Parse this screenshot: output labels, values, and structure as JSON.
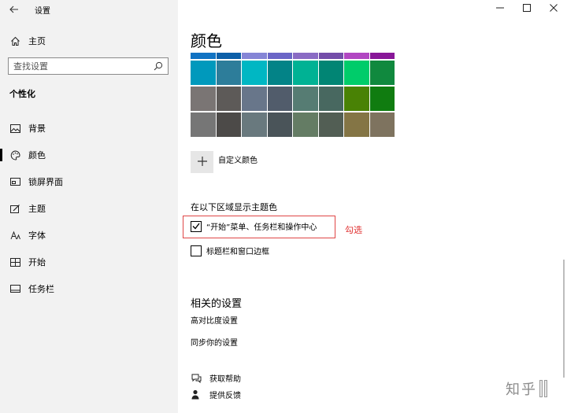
{
  "window": {
    "title": "设置"
  },
  "sidebar": {
    "home_label": "主页",
    "search_placeholder": "查找设置",
    "section_title": "个性化",
    "items": [
      {
        "label": "背景",
        "icon": "picture-icon"
      },
      {
        "label": "颜色",
        "icon": "palette-icon",
        "active": true
      },
      {
        "label": "锁屏界面",
        "icon": "lock-screen-icon"
      },
      {
        "label": "主题",
        "icon": "theme-brush-icon"
      },
      {
        "label": "字体",
        "icon": "font-icon"
      },
      {
        "label": "开始",
        "icon": "start-grid-icon"
      },
      {
        "label": "任务栏",
        "icon": "taskbar-icon"
      }
    ]
  },
  "main": {
    "heading": "颜色",
    "color_strip": [
      "#1173c3",
      "#0c5fa8",
      "#8585d6",
      "#6b66c7",
      "#8a6bc4",
      "#744da9",
      "#b146c2",
      "#881798"
    ],
    "color_rows": [
      [
        "#0099bc",
        "#2d7d9a",
        "#00b7c3",
        "#038387",
        "#00b294",
        "#018574",
        "#00cc6a",
        "#10893e"
      ],
      [
        "#7a7574",
        "#5d5a58",
        "#68768a",
        "#515c6b",
        "#567c73",
        "#486860",
        "#498205",
        "#107c10"
      ],
      [
        "#767676",
        "#4c4a48",
        "#69797e",
        "#4a5459",
        "#647c64",
        "#525e54",
        "#847545",
        "#7e735f"
      ]
    ],
    "custom_color_label": "自定义颜色",
    "show_accent_title": "在以下区域显示主题色",
    "checkbox_start": {
      "label": "“开始”菜单、任务栏和操作中心",
      "checked": true
    },
    "checkbox_titlebar": {
      "label": "标题栏和窗口边框",
      "checked": false
    },
    "annotation": "勾选",
    "related_title": "相关的设置",
    "related_links": [
      "高对比度设置",
      "同步你的设置"
    ],
    "help_items": [
      {
        "label": "获取帮助",
        "icon": "help-chat-icon"
      },
      {
        "label": "提供反馈",
        "icon": "feedback-person-icon"
      }
    ]
  },
  "watermark": {
    "text": "知乎"
  },
  "colors": {
    "accent_annotation": "#e03030"
  }
}
